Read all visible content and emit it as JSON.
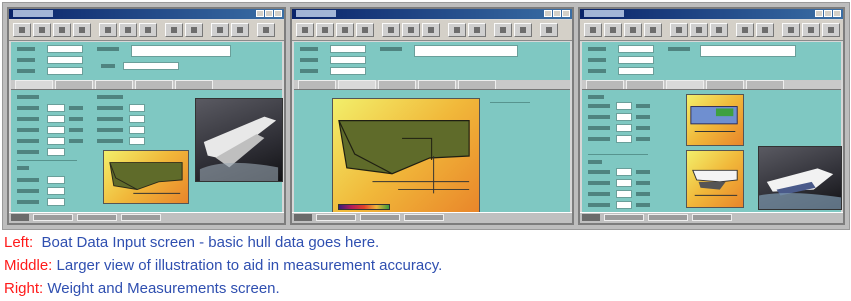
{
  "captions": [
    {
      "label": "Left:",
      "text": "  Boat Data Input screen - basic hull data goes here."
    },
    {
      "label": "Middle:",
      "text": " Larger view of illustration to aid in measurement accuracy."
    },
    {
      "label": "Right:",
      "text": " Weight and Measurements screen."
    }
  ],
  "colors": {
    "caption_label": "#ff1a1a",
    "caption_text": "#2f4fb0",
    "form_background": "#7fc8c2",
    "window_chrome": "#d4d0c8",
    "hull_dark": "#5f6b2a"
  },
  "screenshots": [
    {
      "name": "boat-data-input-screen",
      "icons": [
        "hull-illustration",
        "boat-photo"
      ]
    },
    {
      "name": "hull-illustration-view-screen",
      "icons": [
        "hull-illustration"
      ]
    },
    {
      "name": "weight-and-measurements-screen",
      "icons": [
        "hull-illustration",
        "hull-illustration",
        "boat-photo"
      ]
    }
  ]
}
